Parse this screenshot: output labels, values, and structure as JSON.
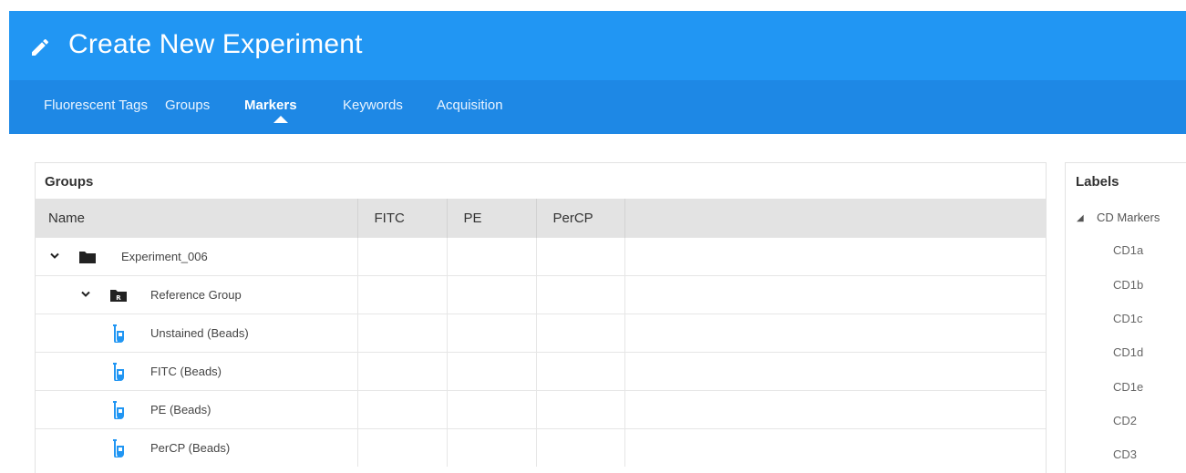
{
  "header": {
    "title": "Create New Experiment",
    "icon": "pencil-icon",
    "color": "#2196f3",
    "tabbar_color": "#1e88e5"
  },
  "tabs": [
    {
      "label": "Fluorescent Tags",
      "active": false
    },
    {
      "label": "Groups",
      "active": false
    },
    {
      "label": "Markers",
      "active": true
    },
    {
      "label": "Keywords",
      "active": false
    },
    {
      "label": "Acquisition",
      "active": false
    }
  ],
  "groups": {
    "title": "Groups",
    "columns": [
      "Name",
      "FITC",
      "PE",
      "PerCP",
      ""
    ],
    "rows": [
      {
        "name": "Experiment_006",
        "icon": "folder-icon",
        "expanded": true
      },
      {
        "name": "Reference Group",
        "icon": "reference-folder-icon",
        "icon_letter": "R",
        "expanded": true
      },
      {
        "name": "Unstained (Beads)",
        "icon": "tube-icon"
      },
      {
        "name": "FITC (Beads)",
        "icon": "tube-icon"
      },
      {
        "name": "PE (Beads)",
        "icon": "tube-icon"
      },
      {
        "name": "PerCP (Beads)",
        "icon": "tube-icon"
      }
    ]
  },
  "labels": {
    "title": "Labels",
    "root": "CD Markers",
    "items": [
      "CD1a",
      "CD1b",
      "CD1c",
      "CD1d",
      "CD1e",
      "CD2",
      "CD3"
    ]
  }
}
